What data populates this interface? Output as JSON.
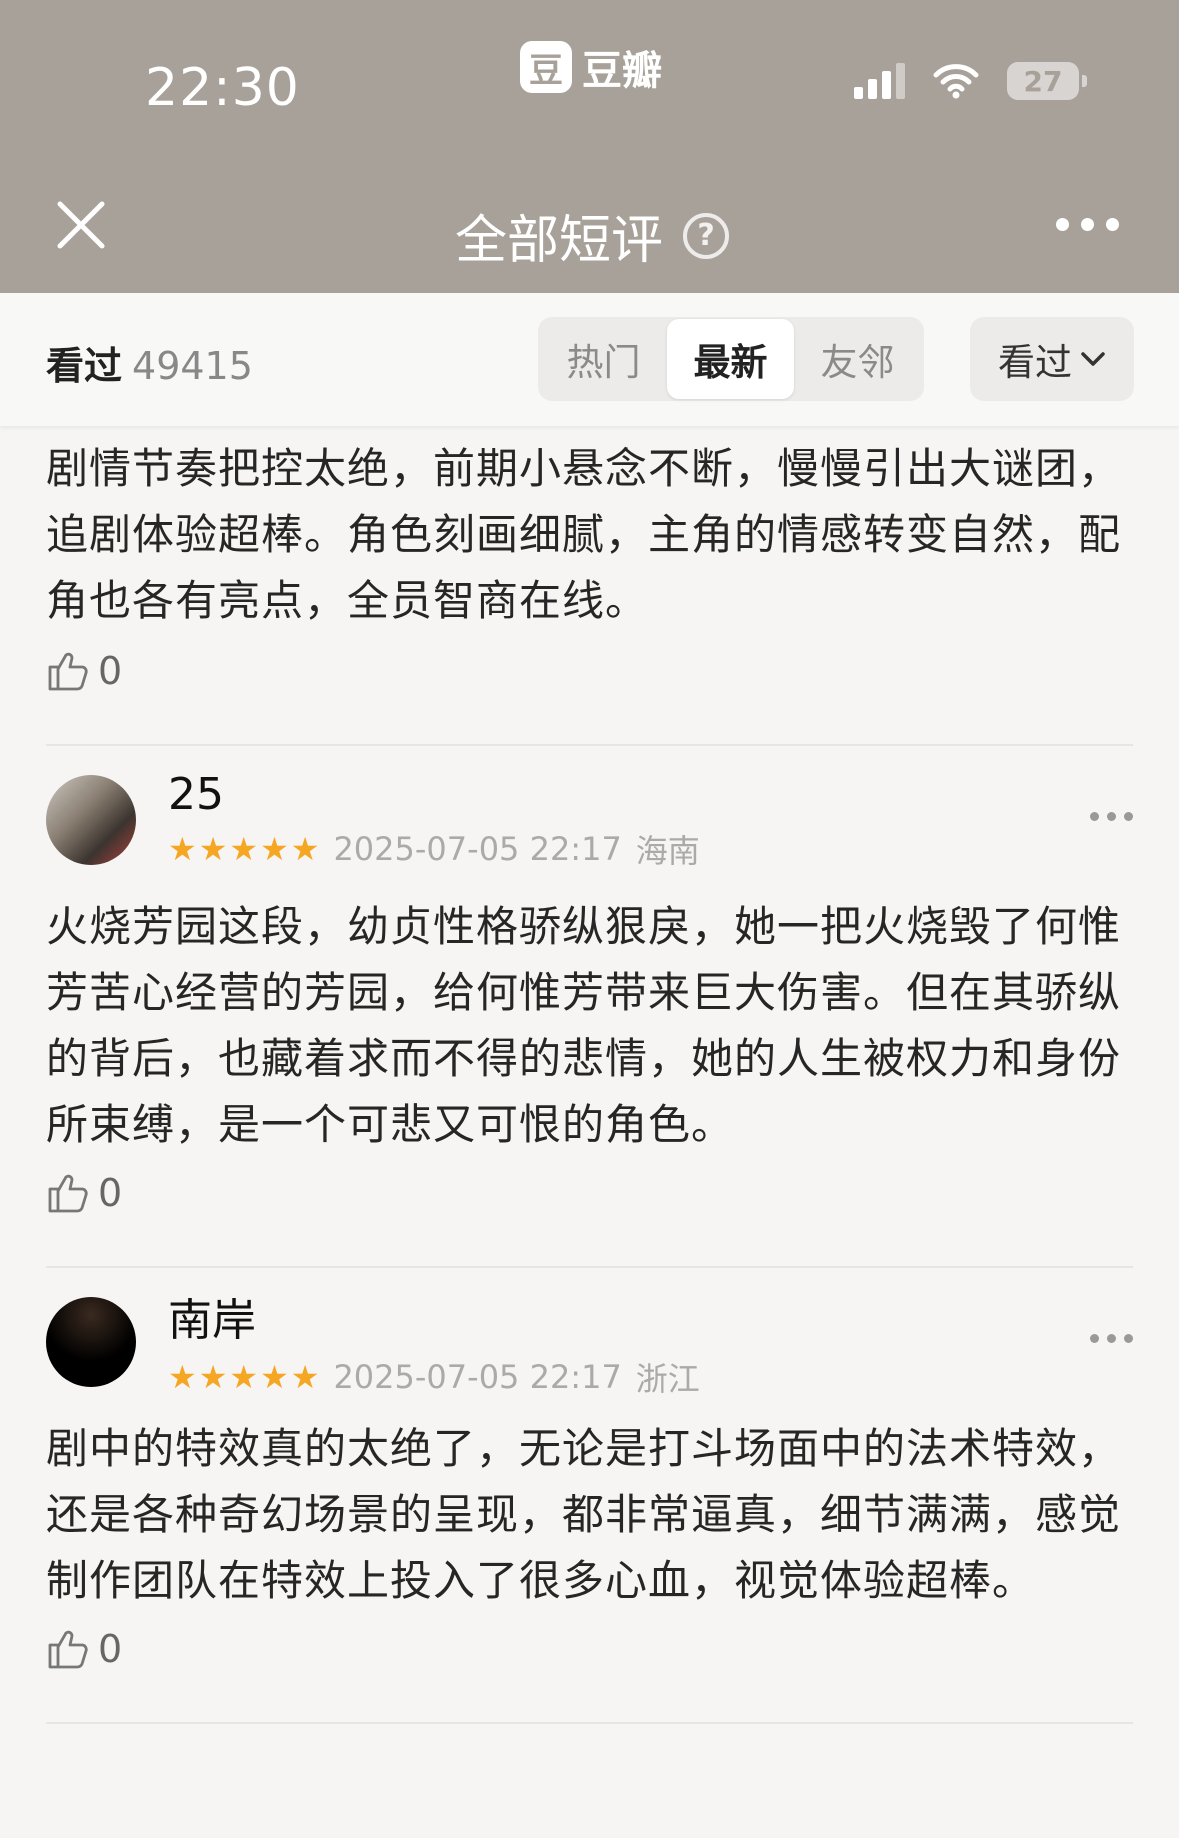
{
  "status_bar": {
    "time": "22:30",
    "battery": "27"
  },
  "brand": {
    "logo_glyph": "豆",
    "name": "豆瓣"
  },
  "nav": {
    "title": "全部短评",
    "help_glyph": "?"
  },
  "filter": {
    "seen_label": "看过",
    "seen_count": "49415",
    "tabs": [
      {
        "label": "热门",
        "active": false
      },
      {
        "label": "最新",
        "active": true
      },
      {
        "label": "友邻",
        "active": false
      }
    ],
    "dropdown_label": "看过"
  },
  "reviews": [
    {
      "text": "剧情节奏把控太绝，前期小悬念不断，慢慢引出大谜团，追剧体验超棒。角色刻画细腻，主角的情感转变自然，配角也各有亮点，全员智商在线。",
      "likes": "0"
    },
    {
      "user": "25",
      "avatar": "photo",
      "rating": 5,
      "date": "2025-07-05 22:17",
      "location": "海南",
      "text": "火烧芳园这段，幼贞性格骄纵狠戾，她一把火烧毁了何惟芳苦心经营的芳园，给何惟芳带来巨大伤害。但在其骄纵的背后，也藏着求而不得的悲情，她的人生被权力和身份所束缚，是一个可悲又可恨的角色。",
      "likes": "0"
    },
    {
      "user": "南岸",
      "avatar": "black",
      "rating": 5,
      "date": "2025-07-05 22:17",
      "location": "浙江",
      "text": "剧中的特效真的太绝了，无论是打斗场面中的法术特效，还是各种奇幻场景的呈现，都非常逼真，细节满满，感觉制作团队在特效上投入了很多心血，视觉体验超棒。",
      "likes": "0"
    }
  ],
  "colors": {
    "header_bg": "#a8a199",
    "star": "#f5a623",
    "page_bg": "#f6f5f3"
  }
}
